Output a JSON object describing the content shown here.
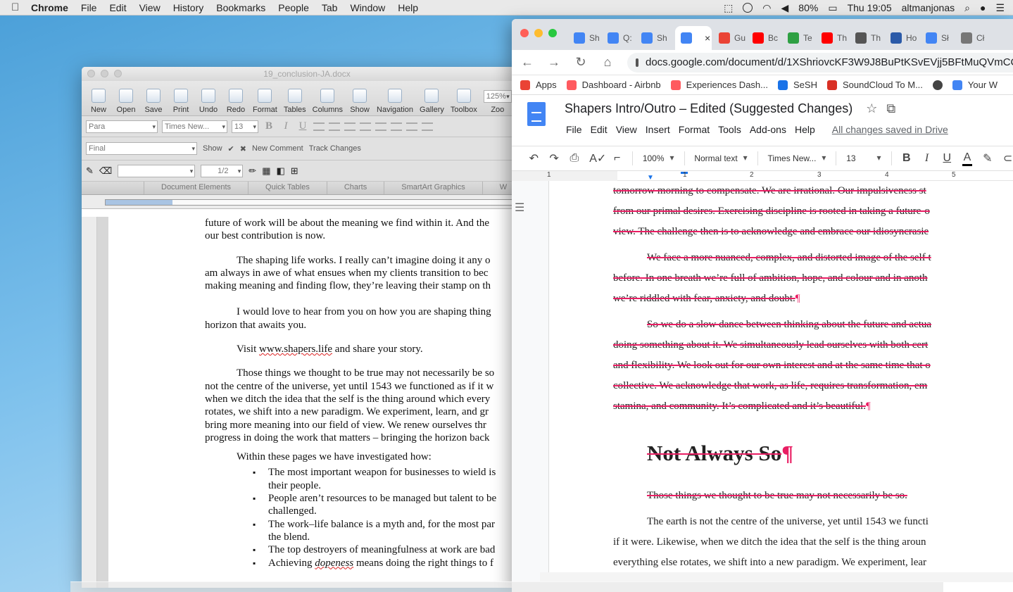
{
  "menubar": {
    "app": "Chrome",
    "items": [
      "File",
      "Edit",
      "View",
      "History",
      "Bookmarks",
      "People",
      "Tab",
      "Window",
      "Help"
    ],
    "battery": "80%",
    "clock": "Thu 19:05",
    "user": "altmanjonas"
  },
  "word": {
    "title": "19_conclusion-JA.docx",
    "toolbar": [
      "New",
      "Open",
      "Save",
      "Print",
      "Undo",
      "Redo",
      "Format",
      "Tables",
      "Columns",
      "Show",
      "Navigation",
      "Gallery",
      "Toolbox"
    ],
    "zoom": "125%",
    "zoom_label": "Zoo",
    "style": "Para",
    "font": "Times New...",
    "size": "13",
    "markup": "Final",
    "show": "Show",
    "new_comment": "New Comment",
    "track_changes": "Track Changes",
    "line_weight": "1/2",
    "ribbon_tabs": [
      "Document Elements",
      "Quick Tables",
      "Charts",
      "SmartArt Graphics",
      "W"
    ],
    "paragraphs": [
      "future of work will be about the meaning we find within it. And the",
      "our best contribution is now.",
      "The shaping life works. I really can’t imagine doing it any o",
      "am always in awe of what ensues when my clients transition to bec",
      "making meaning and finding flow, they’re leaving their stamp on th",
      "I would love to hear from you on how you are shaping thing",
      "horizon that awaits you.",
      "Visit",
      "www.shapers.life",
      "and share your story.",
      "Those things we thought to be true may not necessarily be so",
      "not the centre of the universe, yet until 1543 we functioned as if it w",
      "when we ditch the idea that the self is the thing around which every",
      "rotates, we shift into a new paradigm. We experiment, learn, and gr",
      "bring more meaning into our field of view. We renew ourselves thr",
      "progress in doing the work that matters – bringing the horizon back",
      "Within these pages we have investigated how:"
    ],
    "bullets": [
      [
        "The most important weapon for businesses to wield is",
        "their people."
      ],
      [
        "People aren’t resources to be managed but talent to be",
        "challenged."
      ],
      [
        "The work–life balance is a myth and, for the most par",
        "the blend."
      ],
      [
        "The top destroyers of meaningfulness at work are bad",
        ""
      ],
      [
        "Achieving",
        "dopeness",
        "means doing the right things to f"
      ]
    ]
  },
  "chrome": {
    "tabs": [
      {
        "label": "Sh",
        "color": "#4285f4"
      },
      {
        "label": "Q:",
        "color": "#4285f4"
      },
      {
        "label": "Sh",
        "color": "#4285f4"
      },
      {
        "label": "",
        "color": "#4285f4",
        "close": "×"
      },
      {
        "label": "Gu",
        "color": "#ea4335"
      },
      {
        "label": "Bc",
        "color": "#ff0000"
      },
      {
        "label": "Te",
        "color": "#2ea043"
      },
      {
        "label": "Th",
        "color": "#ff0000"
      },
      {
        "label": "Th",
        "color": "#555555"
      },
      {
        "label": "Ho",
        "color": "#2b5aa8"
      },
      {
        "label": "Sł",
        "color": "#4285f4"
      },
      {
        "label": "Cł",
        "color": "#777777"
      }
    ],
    "url": "docs.google.com/document/d/1XShriovcKF3W9J8BuPtKSvEVjj5BFtMuQVmCC7qV",
    "bookmarks": [
      {
        "label": "Apps",
        "color": "#ea4335"
      },
      {
        "label": "Dashboard - Airbnb",
        "color": "#ff5a5f"
      },
      {
        "label": "Experiences Dash...",
        "color": "#ff5a5f"
      },
      {
        "label": "SeSH",
        "color": "#1a73e8"
      },
      {
        "label": "SoundCloud To M...",
        "color": "#d93025"
      },
      {
        "label": "",
        "color": "#444444"
      },
      {
        "label": "Your W",
        "color": "#4285f4"
      }
    ],
    "doc_title": "Shapers Intro/Outro – Edited (Suggested Changes)",
    "doc_menu": [
      "File",
      "Edit",
      "View",
      "Insert",
      "Format",
      "Tools",
      "Add-ons",
      "Help"
    ],
    "saved": "All changes saved in Drive",
    "zoom": "100%",
    "style": "Normal text",
    "font": "Times New...",
    "size": "13",
    "ruler": [
      "1",
      "1",
      "2",
      "3",
      "4",
      "5"
    ],
    "doc_lines": [
      "tomorrow morning to compensate. We are irrational. Our impulsiveness st",
      "from our primal desires. Exercising discipline is rooted in taking a future-o",
      "view. The challenge then is to acknowledge and embrace our idiosyncrasie",
      "We face a more nuanced, complex, and distorted image of the self t",
      "before. In one breath we’re full of ambition, hope, and colour and in anoth",
      "we’re riddled with fear, anxiety, and doubt.",
      "So we do a slow dance between thinking about the future and actua",
      "doing something about it. We simultaneously lead ourselves with both cert",
      "and flexibility. We look out for our own interest and at the same time that o",
      "collective. We acknowledge that work, as life, requires transformation, em",
      "stamina, and community. It’s complicated and it’s beautiful.",
      "Not Always So",
      "Those things we thought to be true may not necessarily be so.",
      "The earth is not the centre of the universe, yet until 1543 we functi",
      "if it were. Likewise, when we ditch the idea that the self is the thing aroun",
      "everything else rotates, we shift into a new paradigm. We experiment, lear"
    ],
    "pilcrow": "¶"
  }
}
